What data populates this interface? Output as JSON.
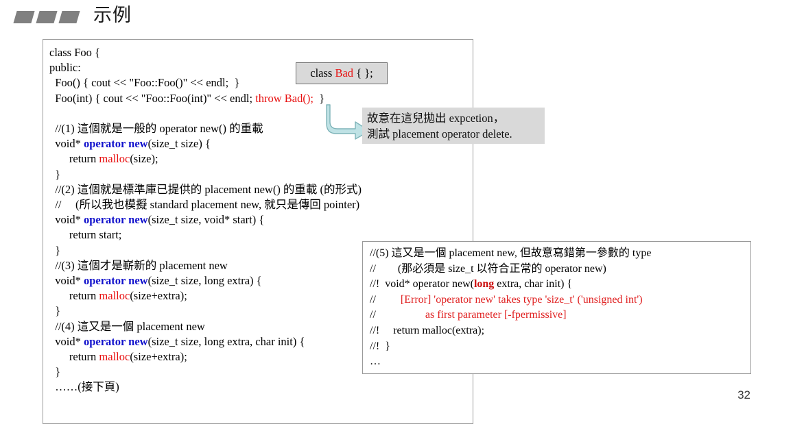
{
  "slide": {
    "title": "示例",
    "page_number": "32",
    "bullet_count": 3,
    "bullet_color": "#808080"
  },
  "colors": {
    "keyword_blue": "#1111cc",
    "malloc_red": "#e81010",
    "error_red": "#e02020",
    "callout_gray": "#d9d9d9",
    "arrow_cyan": "#b9e0e3",
    "box_border": "#9a9a9a"
  },
  "class_bad_callout": {
    "segments": [
      {
        "text": "class ",
        "style": "plain"
      },
      {
        "text": "Bad",
        "style": "red"
      },
      {
        "text": " { };",
        "style": "plain"
      }
    ],
    "plain_text": "class Bad { };"
  },
  "throw_note": {
    "line1": "故意在這兒拋出 expcetion，",
    "line2": "測試 placement operator delete."
  },
  "main_code": {
    "lines": [
      [
        {
          "t": "class Foo {"
        }
      ],
      [
        {
          "t": "public:"
        }
      ],
      [
        {
          "t": "  Foo() { cout << \"Foo::Foo()\" << endl;  }"
        }
      ],
      [
        {
          "t": "  Foo(int) { cout << \"Foo::Foo(int)\" << endl; "
        },
        {
          "t": "throw Bad();",
          "s": "red"
        },
        {
          "t": "  }"
        }
      ],
      [
        {
          "t": " ",
          "s": "blank"
        }
      ],
      [
        {
          "t": "  //(1) 這個就是一般的 operator new() 的重載"
        }
      ],
      [
        {
          "t": "  void* "
        },
        {
          "t": "operator new",
          "s": "kw"
        },
        {
          "t": "(size_t size) {"
        }
      ],
      [
        {
          "t": "       return "
        },
        {
          "t": "malloc",
          "s": "malloc"
        },
        {
          "t": "(size);"
        }
      ],
      [
        {
          "t": "  }"
        }
      ],
      [
        {
          "t": "  //(2) 這個就是標準庫已提供的 placement new() 的重載 (的形式)"
        }
      ],
      [
        {
          "t": "  //     (所以我也模擬 standard placement new, 就只是傳回 pointer)"
        }
      ],
      [
        {
          "t": "  void* "
        },
        {
          "t": "operator new",
          "s": "kw"
        },
        {
          "t": "(size_t size, void* start) {"
        }
      ],
      [
        {
          "t": "       return start;"
        }
      ],
      [
        {
          "t": "  }"
        }
      ],
      [
        {
          "t": "  //(3) 這個才是嶄新的 placement new"
        }
      ],
      [
        {
          "t": "  void* "
        },
        {
          "t": "operator new",
          "s": "kw"
        },
        {
          "t": "(size_t size, long extra) {"
        }
      ],
      [
        {
          "t": "       return "
        },
        {
          "t": "malloc",
          "s": "malloc"
        },
        {
          "t": "(size+extra);"
        }
      ],
      [
        {
          "t": "  }"
        }
      ],
      [
        {
          "t": "  //(4) 這又是一個 placement new"
        }
      ],
      [
        {
          "t": "  void* "
        },
        {
          "t": "operator new",
          "s": "kw"
        },
        {
          "t": "(size_t size, long extra, char init) {"
        }
      ],
      [
        {
          "t": "       return "
        },
        {
          "t": "malloc",
          "s": "malloc"
        },
        {
          "t": "(size+extra);"
        }
      ],
      [
        {
          "t": "  }"
        }
      ],
      [
        {
          "t": "  ……(接下頁)"
        }
      ]
    ]
  },
  "secondary_code": {
    "lines": [
      [
        {
          "t": "//(5) 這又是一個 placement new, 但故意寫錯第一參數的 type"
        }
      ],
      [
        {
          "t": "//        (那必須是 size_t 以符合正常的 operator new)"
        }
      ],
      [
        {
          "t": "//!  void* operator new("
        },
        {
          "t": "long",
          "s": "redb"
        },
        {
          "t": " extra, char init) {"
        }
      ],
      [
        {
          "t": "//         "
        },
        {
          "t": "[Error] 'operator new' takes type 'size_t' ('unsigned int')",
          "s": "err"
        }
      ],
      [
        {
          "t": "//                  "
        },
        {
          "t": "as first parameter [-fpermissive]",
          "s": "err"
        }
      ],
      [
        {
          "t": "//!     return malloc(extra);"
        }
      ],
      [
        {
          "t": "//!  }"
        }
      ],
      [
        {
          "t": "…"
        }
      ]
    ]
  }
}
